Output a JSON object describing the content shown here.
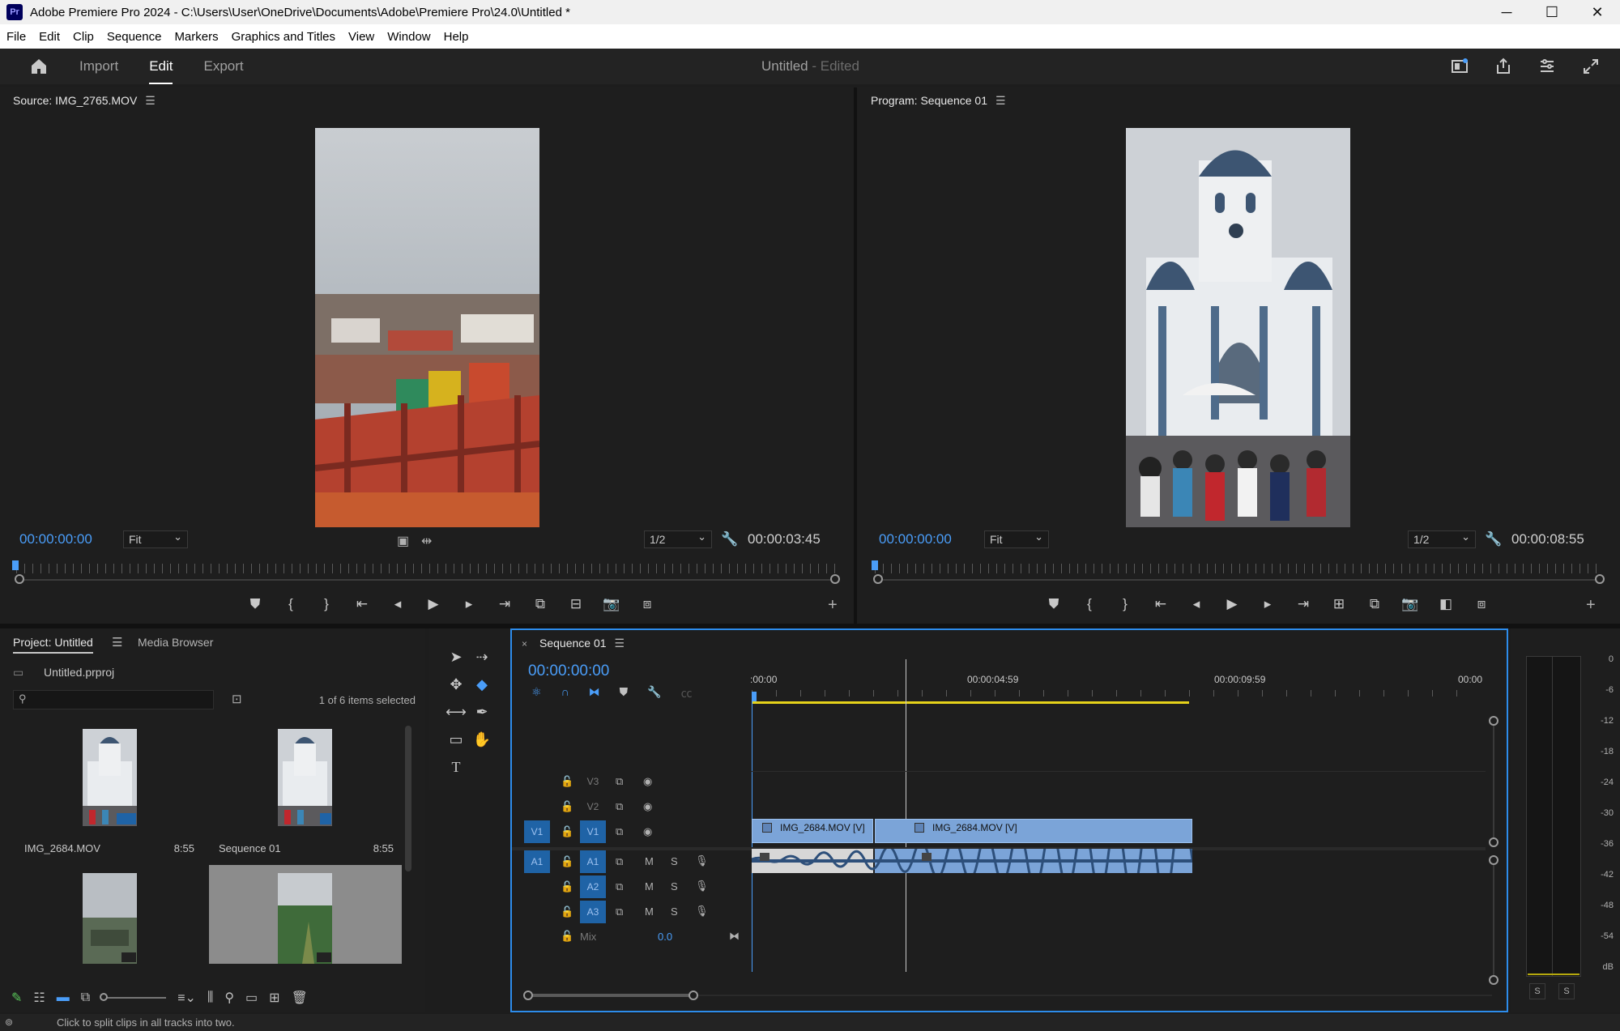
{
  "app": {
    "title": "Adobe Premiere Pro 2024 - C:\\Users\\User\\OneDrive\\Documents\\Adobe\\Premiere Pro\\24.0\\Untitled *",
    "icon_text": "Pr"
  },
  "menu": [
    "File",
    "Edit",
    "Clip",
    "Sequence",
    "Markers",
    "Graphics and Titles",
    "View",
    "Window",
    "Help"
  ],
  "header": {
    "workspaces": [
      "Import",
      "Edit",
      "Export"
    ],
    "active_workspace": "Edit",
    "doc_title": "Untitled",
    "doc_status": "- Edited"
  },
  "source": {
    "title": "Source: IMG_2765.MOV",
    "timecode": "00:00:00:00",
    "fit": "Fit",
    "resolution": "1/2",
    "duration": "00:00:03:45"
  },
  "program": {
    "title": "Program: Sequence 01",
    "timecode": "00:00:00:00",
    "fit": "Fit",
    "resolution": "1/2",
    "duration": "00:00:08:55"
  },
  "project": {
    "tab": "Project: Untitled",
    "tab2": "Media Browser",
    "file": "Untitled.prproj",
    "selection": "1 of 6 items selected",
    "items": [
      {
        "name": "IMG_2684.MOV",
        "duration": "8:55"
      },
      {
        "name": "Sequence 01",
        "duration": "8:55"
      }
    ]
  },
  "timeline": {
    "tab": "Sequence 01",
    "timecode": "00:00:00:00",
    "ruler": [
      ":00:00",
      "00:00:04:59",
      "00:00:09:59",
      "00:00"
    ],
    "video_tracks": [
      "V3",
      "V2",
      "V1"
    ],
    "audio_tracks": [
      "A1",
      "A2",
      "A3"
    ],
    "source_v": "V1",
    "source_a": "A1",
    "mix_label": "Mix",
    "mix_value": "0.0",
    "mute": "M",
    "solo": "S",
    "clips": {
      "v1a": "IMG_2684.MOV [V]",
      "v1b": "IMG_2684.MOV [V]"
    }
  },
  "meter": {
    "labels": [
      "0",
      "-6",
      "-12",
      "-18",
      "-24",
      "-30",
      "-36",
      "-42",
      "-48",
      "-54",
      "dB"
    ],
    "solo_left": "S",
    "solo_right": "S"
  },
  "status": "Click to split clips in all tracks into two.",
  "colors": {
    "accent": "#4a9df8",
    "clip_video": "#7ba4d8",
    "work_area": "#e6d21a",
    "track_target": "#1f63a6"
  }
}
